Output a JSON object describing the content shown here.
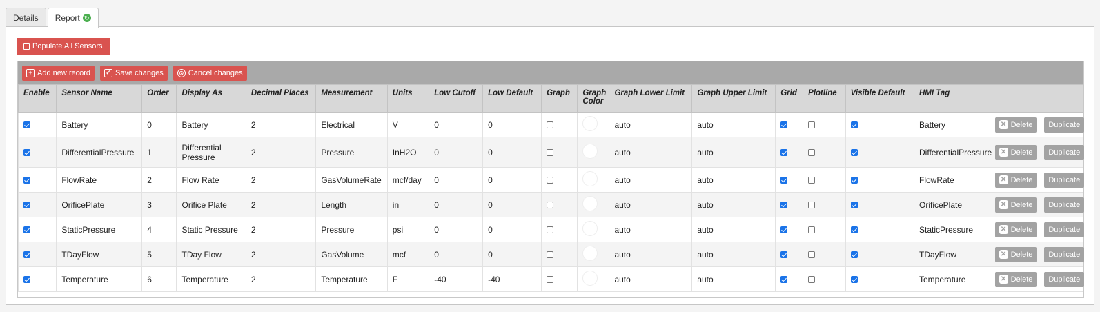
{
  "tabs": [
    {
      "label": "Details"
    },
    {
      "label": "Report"
    }
  ],
  "populate_label": "Populate All Sensors",
  "toolbar": {
    "add_label": "Add new record",
    "save_label": "Save changes",
    "cancel_label": "Cancel changes"
  },
  "columns": [
    "Enable",
    "Sensor Name",
    "Order",
    "Display As",
    "Decimal Places",
    "Measurement",
    "Units",
    "Low Cutoff",
    "Low Default",
    "Graph",
    "Graph Color",
    "Graph Lower Limit",
    "Graph Upper Limit",
    "Grid",
    "Plotline",
    "Visible Default",
    "HMI Tag",
    "",
    ""
  ],
  "rows": [
    {
      "enable": true,
      "sensor": "Battery",
      "order": "0",
      "display": "Battery",
      "decimals": "2",
      "measurement": "Electrical",
      "units": "V",
      "low_cutoff": "0",
      "low_default": "0",
      "graph": false,
      "lower": "auto",
      "upper": "auto",
      "grid": true,
      "plotline": false,
      "visible": true,
      "hmi": "Battery"
    },
    {
      "enable": true,
      "sensor": "DifferentialPressure",
      "order": "1",
      "display": "Differential Pressure",
      "decimals": "2",
      "measurement": "Pressure",
      "units": "InH2O",
      "low_cutoff": "0",
      "low_default": "0",
      "graph": false,
      "lower": "auto",
      "upper": "auto",
      "grid": true,
      "plotline": false,
      "visible": true,
      "hmi": "DifferentialPressure"
    },
    {
      "enable": true,
      "sensor": "FlowRate",
      "order": "2",
      "display": "Flow Rate",
      "decimals": "2",
      "measurement": "GasVolumeRate",
      "units": "mcf/day",
      "low_cutoff": "0",
      "low_default": "0",
      "graph": false,
      "lower": "auto",
      "upper": "auto",
      "grid": true,
      "plotline": false,
      "visible": true,
      "hmi": "FlowRate"
    },
    {
      "enable": true,
      "sensor": "OrificePlate",
      "order": "3",
      "display": "Orifice Plate",
      "decimals": "2",
      "measurement": "Length",
      "units": "in",
      "low_cutoff": "0",
      "low_default": "0",
      "graph": false,
      "lower": "auto",
      "upper": "auto",
      "grid": true,
      "plotline": false,
      "visible": true,
      "hmi": "OrificePlate"
    },
    {
      "enable": true,
      "sensor": "StaticPressure",
      "order": "4",
      "display": "Static Pressure",
      "decimals": "2",
      "measurement": "Pressure",
      "units": "psi",
      "low_cutoff": "0",
      "low_default": "0",
      "graph": false,
      "lower": "auto",
      "upper": "auto",
      "grid": true,
      "plotline": false,
      "visible": true,
      "hmi": "StaticPressure"
    },
    {
      "enable": true,
      "sensor": "TDayFlow",
      "order": "5",
      "display": "TDay Flow",
      "decimals": "2",
      "measurement": "GasVolume",
      "units": "mcf",
      "low_cutoff": "0",
      "low_default": "0",
      "graph": false,
      "lower": "auto",
      "upper": "auto",
      "grid": true,
      "plotline": false,
      "visible": true,
      "hmi": "TDayFlow"
    },
    {
      "enable": true,
      "sensor": "Temperature",
      "order": "6",
      "display": "Temperature",
      "decimals": "2",
      "measurement": "Temperature",
      "units": "F",
      "low_cutoff": "-40",
      "low_default": "-40",
      "graph": false,
      "lower": "auto",
      "upper": "auto",
      "grid": true,
      "plotline": false,
      "visible": true,
      "hmi": "Temperature"
    }
  ],
  "delete_label": "Delete",
  "duplicate_label": "Duplicate",
  "colors": {
    "accent": "#d9534f",
    "toolbar": "#a9a9a9",
    "muted_button": "#a3a3a3",
    "checkbox": "#1a73e8"
  },
  "icons": {
    "refresh": "refresh-icon",
    "save": "floppy-icon",
    "add": "plus-icon",
    "check": "check-icon",
    "cancel": "cancel-icon",
    "delete": "close-icon"
  }
}
